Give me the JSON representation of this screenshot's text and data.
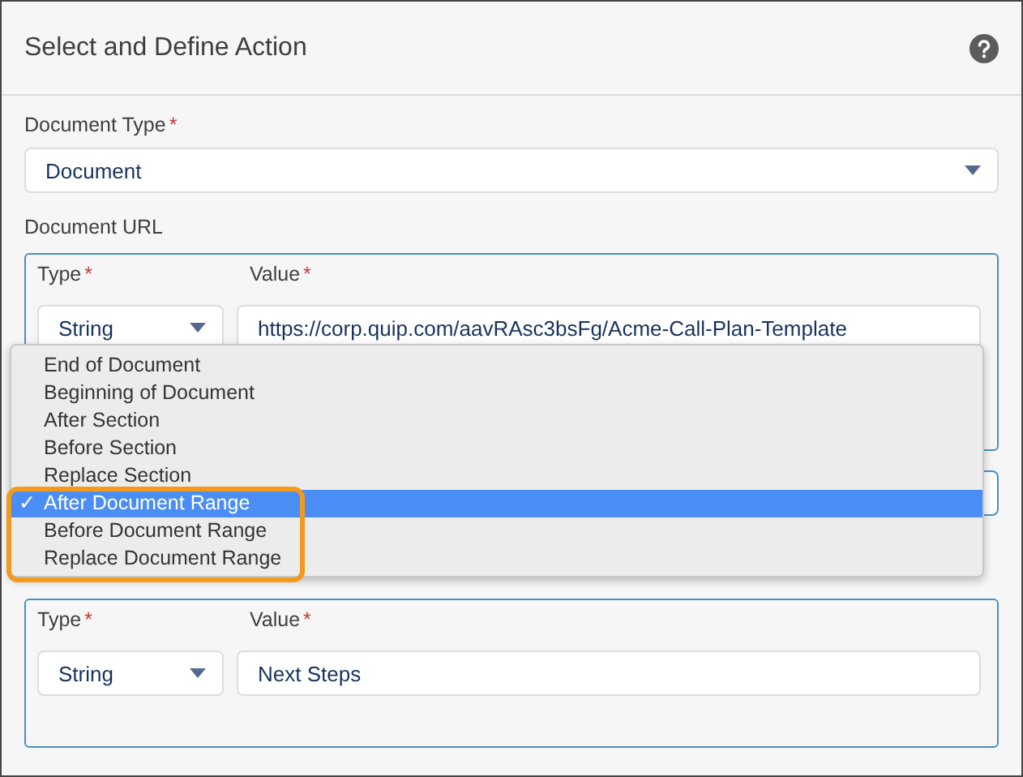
{
  "header": {
    "title": "Select and Define Action"
  },
  "document_type": {
    "label": "Document Type",
    "required_mark": "*",
    "value": "Document"
  },
  "document_url": {
    "label": "Document URL",
    "type_label": "Type",
    "type_required_mark": "*",
    "value_label": "Value",
    "value_required_mark": "*",
    "type_value": "String",
    "value": "https://corp.quip.com/aavRAsc3bsFg/Acme-Call-Plan-Template"
  },
  "range_group": {
    "type_label": "Type",
    "type_required_mark": "*",
    "value_label": "Value",
    "value_required_mark": "*",
    "type_value": "String",
    "value": "Next Steps"
  },
  "menu": {
    "options": [
      {
        "label": "End of Document",
        "selected": false
      },
      {
        "label": "Beginning of Document",
        "selected": false
      },
      {
        "label": "After Section",
        "selected": false
      },
      {
        "label": "Before Section",
        "selected": false
      },
      {
        "label": "Replace Section",
        "selected": false
      },
      {
        "label": "After Document Range",
        "selected": true
      },
      {
        "label": "Before Document Range",
        "selected": false
      },
      {
        "label": "Replace Document Range",
        "selected": false
      }
    ],
    "check_mark": "✓"
  }
}
